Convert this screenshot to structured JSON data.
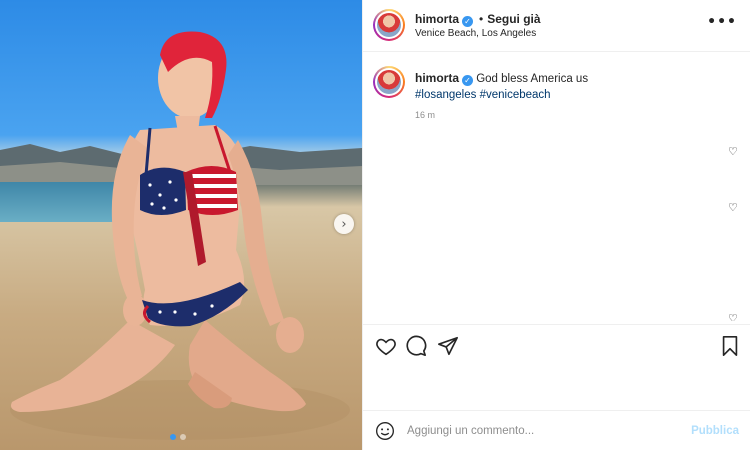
{
  "post": {
    "username": "himorta",
    "follow_separator": "•",
    "follow_label": "Segui già",
    "location": "Venice Beach, Los Angeles",
    "more_label": "•••",
    "caption_text": "God bless America us",
    "hashtags": "#losangeles #venicebeach",
    "timestamp": "16 m",
    "carousel": {
      "slides": 2,
      "active_slide": 1
    }
  },
  "icons": {
    "verified": "verified-badge-icon",
    "next": "chevron-right-icon",
    "like": "heart-icon",
    "comment": "comment-bubble-icon",
    "share": "paper-plane-icon",
    "save": "bookmark-icon",
    "emoji": "smiley-icon",
    "comment_like": "small-heart-icon"
  },
  "glyphs": {
    "verified": "✓",
    "next": "›",
    "comment_like": "♡"
  },
  "add_comment": {
    "placeholder": "Aggiungi un commento...",
    "publish_label": "Pubblica"
  },
  "colors": {
    "link": "#00376b",
    "verified": "#3897f0",
    "publish_disabled": "#b2dffc",
    "secondary_text": "#8e8e8e"
  }
}
